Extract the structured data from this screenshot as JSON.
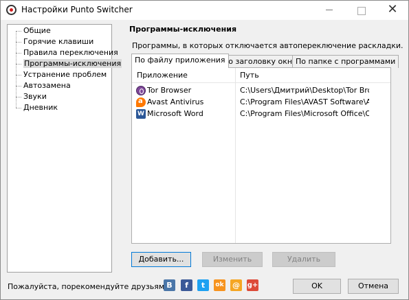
{
  "window": {
    "title": "Настройки Punto Switcher"
  },
  "sidebar": {
    "items": [
      {
        "label": "Общие",
        "selected": false
      },
      {
        "label": "Горячие клавиши",
        "selected": false
      },
      {
        "label": "Правила переключения",
        "selected": false
      },
      {
        "label": "Программы-исключения",
        "selected": true
      },
      {
        "label": "Устранение проблем",
        "selected": false
      },
      {
        "label": "Автозамена",
        "selected": false
      },
      {
        "label": "Звуки",
        "selected": false
      },
      {
        "label": "Дневник",
        "selected": false
      }
    ]
  },
  "main": {
    "section_title": "Программы-исключения",
    "description": "Программы, в которых отключается автопереключение раскладки.",
    "tabs": [
      {
        "label": "По файлу приложения",
        "active": true
      },
      {
        "label": "По заголовку окна",
        "active": false
      },
      {
        "label": "По папке с программами",
        "active": false
      }
    ],
    "columns": {
      "app": "Приложение",
      "path": "Путь"
    },
    "rows": [
      {
        "app": "Tor Browser",
        "path": "C:\\Users\\Дмитрий\\Desktop\\Tor Bro...",
        "icon": "tor-browser-icon"
      },
      {
        "app": "Avast Antivirus",
        "path": "C:\\Program Files\\AVAST Software\\A...",
        "icon": "avast-icon"
      },
      {
        "app": "Microsoft Word",
        "path": "C:\\Program Files\\Microsoft Office\\Of...",
        "icon": "word-icon"
      }
    ],
    "buttons": {
      "add": "Добавить...",
      "edit": "Изменить",
      "delete": "Удалить"
    }
  },
  "footer": {
    "recommend": "Пожалуйста, порекомендуйте друзьям:",
    "social": [
      {
        "name": "vk",
        "glyph": "B",
        "color": "#4a76a8"
      },
      {
        "name": "facebook",
        "glyph": "f",
        "color": "#3b5998"
      },
      {
        "name": "twitter",
        "glyph": "t",
        "color": "#1da1f2"
      },
      {
        "name": "odnoklassniki",
        "glyph": "ok",
        "color": "#f7931e"
      },
      {
        "name": "mail",
        "glyph": "@",
        "color": "#f5a623"
      },
      {
        "name": "google-plus",
        "glyph": "g+",
        "color": "#dd4b39"
      }
    ],
    "ok": "OK",
    "cancel": "Отмена"
  }
}
